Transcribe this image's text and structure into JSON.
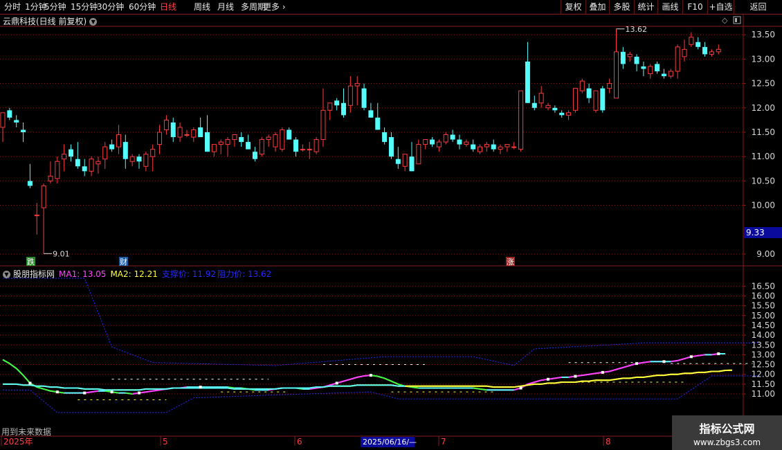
{
  "toolbar": {
    "period_items": [
      "分时",
      "1分钟",
      "5分钟",
      "15分钟",
      "30分钟",
      "60分钟",
      "日线",
      "周线",
      "月线",
      "多周期",
      "更多"
    ],
    "active_period": "日线",
    "right_items": [
      "复权",
      "叠加",
      "多股",
      "统计",
      "画线",
      "F10",
      "+自选",
      "返回"
    ]
  },
  "stock": {
    "title": "云鼎科技(日线 前复权)",
    "cursor_price": "9.33"
  },
  "indicator": {
    "name": "股朋指标网",
    "ma1": "MA1: 13.05",
    "ma2": "MA2: 12.21",
    "support_label": "支撑价: 11.92",
    "resistance_label": "阻力价: 13.62",
    "note": "用到未来数据"
  },
  "time_axis": {
    "labels": [
      "2025年",
      "5",
      "6",
      "7",
      "8"
    ],
    "cursor_date": "2025/06/16/—"
  },
  "watermark": {
    "line1": "指标公式网",
    "line2": "www.zbgs3.com"
  },
  "colors": {
    "up": "#ff3c3c",
    "down": "#54fcfc",
    "ma1": "#ff44ff",
    "ma2": "#ffff3c",
    "band": "#2828ff",
    "grid": "#8a1c1c"
  },
  "chart_data": [
    {
      "type": "candlestick",
      "title": "云鼎科技(日线 前复权)",
      "y_ticks": [
        9.0,
        10.0,
        10.5,
        11.0,
        11.5,
        12.0,
        12.5,
        13.0,
        13.5
      ],
      "ylim": [
        8.9,
        13.78
      ],
      "annotations": [
        {
          "text": "9.01",
          "value": 9.01,
          "type": "low"
        },
        {
          "text": "13.62",
          "value": 13.62,
          "type": "high"
        },
        {
          "text": "跌",
          "kind": "event"
        },
        {
          "text": "财",
          "kind": "event"
        },
        {
          "text": "涨",
          "kind": "event"
        }
      ],
      "candles": [
        [
          11.6,
          11.9,
          11.3,
          11.9
        ],
        [
          11.95,
          12.0,
          11.75,
          11.8
        ],
        [
          11.75,
          11.85,
          11.6,
          11.7
        ],
        [
          11.55,
          11.7,
          11.3,
          11.5
        ],
        [
          10.5,
          10.85,
          10.35,
          10.4
        ],
        [
          9.8,
          10.05,
          9.4,
          9.8
        ],
        [
          9.95,
          10.45,
          9.01,
          10.4
        ],
        [
          10.5,
          10.9,
          10.45,
          10.6
        ],
        [
          10.55,
          11.0,
          10.45,
          10.9
        ],
        [
          10.95,
          11.25,
          10.7,
          11.05
        ],
        [
          11.15,
          11.25,
          10.9,
          11.0
        ],
        [
          10.95,
          11.3,
          10.75,
          10.8
        ],
        [
          10.8,
          10.95,
          10.6,
          10.7
        ],
        [
          10.7,
          11.0,
          10.6,
          10.95
        ],
        [
          10.85,
          11.0,
          10.65,
          10.9
        ],
        [
          10.95,
          11.3,
          10.75,
          11.2
        ],
        [
          11.25,
          11.35,
          11.1,
          11.15
        ],
        [
          11.2,
          11.65,
          11.05,
          11.45
        ],
        [
          11.3,
          11.45,
          10.75,
          10.95
        ],
        [
          10.9,
          11.05,
          10.8,
          11.0
        ],
        [
          11.0,
          11.05,
          10.75,
          10.9
        ],
        [
          10.8,
          11.1,
          10.7,
          11.05
        ],
        [
          11.0,
          11.25,
          10.7,
          11.15
        ],
        [
          11.25,
          11.65,
          11.05,
          11.5
        ],
        [
          11.55,
          11.85,
          11.45,
          11.75
        ],
        [
          11.7,
          11.8,
          11.3,
          11.4
        ],
        [
          11.4,
          11.7,
          11.3,
          11.6
        ],
        [
          11.45,
          11.55,
          11.4,
          11.45
        ],
        [
          11.4,
          11.6,
          11.3,
          11.55
        ],
        [
          11.6,
          11.8,
          11.55,
          11.4
        ],
        [
          11.5,
          11.85,
          11.1,
          11.1
        ],
        [
          11.1,
          11.25,
          11.0,
          11.25
        ],
        [
          11.25,
          11.35,
          11.05,
          11.3
        ],
        [
          11.25,
          11.4,
          11.0,
          11.35
        ],
        [
          11.35,
          11.45,
          11.2,
          11.45
        ],
        [
          11.4,
          11.5,
          11.2,
          11.3
        ],
        [
          11.3,
          11.45,
          11.15,
          11.15
        ],
        [
          11.1,
          11.2,
          10.9,
          10.95
        ],
        [
          11.05,
          11.4,
          11.0,
          11.35
        ],
        [
          11.35,
          11.45,
          11.2,
          11.4
        ],
        [
          11.2,
          11.5,
          11.1,
          11.45
        ],
        [
          11.15,
          11.6,
          11.1,
          11.55
        ],
        [
          11.55,
          11.6,
          11.35,
          11.35
        ],
        [
          11.35,
          11.4,
          11.0,
          11.1
        ],
        [
          11.15,
          11.25,
          11.1,
          11.15
        ],
        [
          11.15,
          11.3,
          10.95,
          11.15
        ],
        [
          11.1,
          11.4,
          11.05,
          11.35
        ],
        [
          11.35,
          12.4,
          11.2,
          11.95
        ],
        [
          11.95,
          12.1,
          11.75,
          12.1
        ],
        [
          12.15,
          12.2,
          11.95,
          12.05
        ],
        [
          12.1,
          12.4,
          11.8,
          11.85
        ],
        [
          12.05,
          12.65,
          11.9,
          12.45
        ],
        [
          12.45,
          12.65,
          12.05,
          12.5
        ],
        [
          12.4,
          12.5,
          11.95,
          12.0
        ],
        [
          11.95,
          12.1,
          11.8,
          11.8
        ],
        [
          11.8,
          12.1,
          11.7,
          11.55
        ],
        [
          11.5,
          11.6,
          11.25,
          11.3
        ],
        [
          11.4,
          11.5,
          10.95,
          11.0
        ],
        [
          10.95,
          11.2,
          10.75,
          10.85
        ],
        [
          10.8,
          11.05,
          10.7,
          11.05
        ],
        [
          11.0,
          11.3,
          10.7,
          10.7
        ],
        [
          10.85,
          11.35,
          10.85,
          11.25
        ],
        [
          11.25,
          11.35,
          11.15,
          11.35
        ],
        [
          11.35,
          11.4,
          11.2,
          11.25
        ],
        [
          11.2,
          11.35,
          11.1,
          11.3
        ],
        [
          11.3,
          11.5,
          11.25,
          11.45
        ],
        [
          11.45,
          11.55,
          11.3,
          11.35
        ],
        [
          11.35,
          11.45,
          11.15,
          11.25
        ],
        [
          11.25,
          11.35,
          11.2,
          11.3
        ],
        [
          11.25,
          11.35,
          11.1,
          11.15
        ],
        [
          11.1,
          11.25,
          11.05,
          11.2
        ],
        [
          11.2,
          11.3,
          11.1,
          11.25
        ],
        [
          11.25,
          11.35,
          11.1,
          11.15
        ],
        [
          11.15,
          11.25,
          11.05,
          11.2
        ],
        [
          11.2,
          11.25,
          11.1,
          11.25
        ],
        [
          11.2,
          11.3,
          11.15,
          11.2
        ],
        [
          11.15,
          12.35,
          11.1,
          12.35
        ],
        [
          12.95,
          13.35,
          12.1,
          12.1
        ],
        [
          12.1,
          12.25,
          11.95,
          12.0
        ],
        [
          12.1,
          12.45,
          12.0,
          12.3
        ],
        [
          12.0,
          12.1,
          11.95,
          12.05
        ],
        [
          12.0,
          12.05,
          11.9,
          11.95
        ],
        [
          11.9,
          11.95,
          11.8,
          11.85
        ],
        [
          11.85,
          11.95,
          11.75,
          11.9
        ],
        [
          11.95,
          12.4,
          11.9,
          12.4
        ],
        [
          12.35,
          12.6,
          12.3,
          12.55
        ],
        [
          12.4,
          12.5,
          12.1,
          12.2
        ],
        [
          11.95,
          12.35,
          11.9,
          12.35
        ],
        [
          12.4,
          12.45,
          11.9,
          11.95
        ],
        [
          12.4,
          12.6,
          12.3,
          12.5
        ],
        [
          12.2,
          13.62,
          12.2,
          13.15
        ],
        [
          13.15,
          13.25,
          12.8,
          12.9
        ],
        [
          13.05,
          13.15,
          12.95,
          13.1
        ],
        [
          13.05,
          13.1,
          12.75,
          12.9
        ],
        [
          12.85,
          12.95,
          12.65,
          12.8
        ],
        [
          12.7,
          12.9,
          12.6,
          12.85
        ],
        [
          12.9,
          12.95,
          12.7,
          12.75
        ],
        [
          12.7,
          12.8,
          12.6,
          12.65
        ],
        [
          12.65,
          12.8,
          12.6,
          12.75
        ],
        [
          12.75,
          13.3,
          12.6,
          13.25
        ],
        [
          13.05,
          13.4,
          12.95,
          13.2
        ],
        [
          13.3,
          13.55,
          13.25,
          13.45
        ],
        [
          13.35,
          13.45,
          13.2,
          13.25
        ],
        [
          13.25,
          13.35,
          13.05,
          13.1
        ],
        [
          13.1,
          13.2,
          13.05,
          13.15
        ],
        [
          13.15,
          13.3,
          13.1,
          13.2
        ]
      ]
    },
    {
      "type": "line",
      "title": "股朋指标网",
      "y_ticks": [
        11.0,
        11.5,
        12.0,
        12.5,
        13.0,
        13.5,
        14.0,
        14.5,
        15.0,
        15.5,
        16.0,
        16.5
      ],
      "ylim": [
        9.9,
        17.1
      ],
      "series": [
        {
          "name": "MA1",
          "values": [
            12.75,
            12.55,
            12.3,
            11.95,
            11.55,
            11.35,
            11.25,
            11.15,
            11.1,
            11.05,
            11.05,
            11.05,
            11.05,
            11.1,
            11.15,
            11.15,
            11.1,
            11.05,
            11.05,
            11.0,
            11.05,
            11.1,
            11.15,
            11.2,
            11.25,
            11.3,
            11.3,
            11.35,
            11.35,
            11.35,
            11.35,
            11.35,
            11.35,
            11.35,
            11.3,
            11.3,
            11.25,
            11.2,
            11.2,
            11.2,
            11.25,
            11.3,
            11.3,
            11.3,
            11.25,
            11.25,
            11.3,
            11.35,
            11.45,
            11.55,
            11.65,
            11.75,
            11.85,
            11.92,
            11.95,
            11.9,
            11.8,
            11.65,
            11.5,
            11.4,
            11.35,
            11.3,
            11.3,
            11.3,
            11.3,
            11.3,
            11.3,
            11.3,
            11.3,
            11.3,
            11.25,
            11.2,
            11.2,
            11.2,
            11.2,
            11.2,
            11.3,
            11.5,
            11.6,
            11.7,
            11.75,
            11.8,
            11.85,
            11.85,
            11.9,
            11.95,
            12.0,
            12.05,
            12.1,
            12.15,
            12.25,
            12.35,
            12.45,
            12.55,
            12.6,
            12.65,
            12.65,
            12.65,
            12.65,
            12.7,
            12.8,
            12.9,
            12.95,
            13.0,
            13.0,
            13.05,
            13.05
          ]
        },
        {
          "name": "MA2",
          "values": [
            11.5,
            11.5,
            11.5,
            11.45,
            11.45,
            11.4,
            11.4,
            11.35,
            11.35,
            11.3,
            11.3,
            11.3,
            11.25,
            11.25,
            11.25,
            11.2,
            11.2,
            11.2,
            11.2,
            11.2,
            11.2,
            11.25,
            11.25,
            11.25,
            11.25,
            11.3,
            11.3,
            11.3,
            11.3,
            11.3,
            11.3,
            11.3,
            11.3,
            11.3,
            11.25,
            11.25,
            11.25,
            11.25,
            11.25,
            11.25,
            11.25,
            11.3,
            11.3,
            11.3,
            11.3,
            11.3,
            11.35,
            11.35,
            11.4,
            11.4,
            11.4,
            11.4,
            11.45,
            11.45,
            11.45,
            11.45,
            11.45,
            11.45,
            11.4,
            11.4,
            11.4,
            11.4,
            11.4,
            11.4,
            11.4,
            11.4,
            11.4,
            11.4,
            11.4,
            11.4,
            11.4,
            11.4,
            11.35,
            11.35,
            11.35,
            11.35,
            11.4,
            11.45,
            11.5,
            11.5,
            11.55,
            11.55,
            11.6,
            11.6,
            11.6,
            11.65,
            11.65,
            11.7,
            11.7,
            11.7,
            11.75,
            11.8,
            11.8,
            11.85,
            11.85,
            11.9,
            11.95,
            11.95,
            12.0,
            12.0,
            12.05,
            12.05,
            12.1,
            12.1,
            12.15,
            12.15,
            12.2,
            12.21
          ]
        }
      ],
      "band": {
        "upper_steps": [
          [
            0,
            16.9
          ],
          [
            12,
            16.9
          ],
          [
            16,
            13.4
          ],
          [
            22,
            12.6
          ],
          [
            40,
            12.45
          ],
          [
            56,
            12.9
          ],
          [
            69,
            12.9
          ],
          [
            75,
            12.45
          ],
          [
            78,
            13.3
          ],
          [
            94,
            13.6
          ],
          [
            111,
            13.6
          ]
        ],
        "lower_steps": [
          [
            0,
            11.2
          ],
          [
            4,
            11.2
          ],
          [
            8,
            10.05
          ],
          [
            24,
            10.05
          ],
          [
            28,
            10.8
          ],
          [
            40,
            10.95
          ],
          [
            54,
            11.1
          ],
          [
            58,
            10.75
          ],
          [
            99,
            10.75
          ],
          [
            104,
            11.92
          ],
          [
            111,
            11.92
          ]
        ]
      }
    }
  ]
}
